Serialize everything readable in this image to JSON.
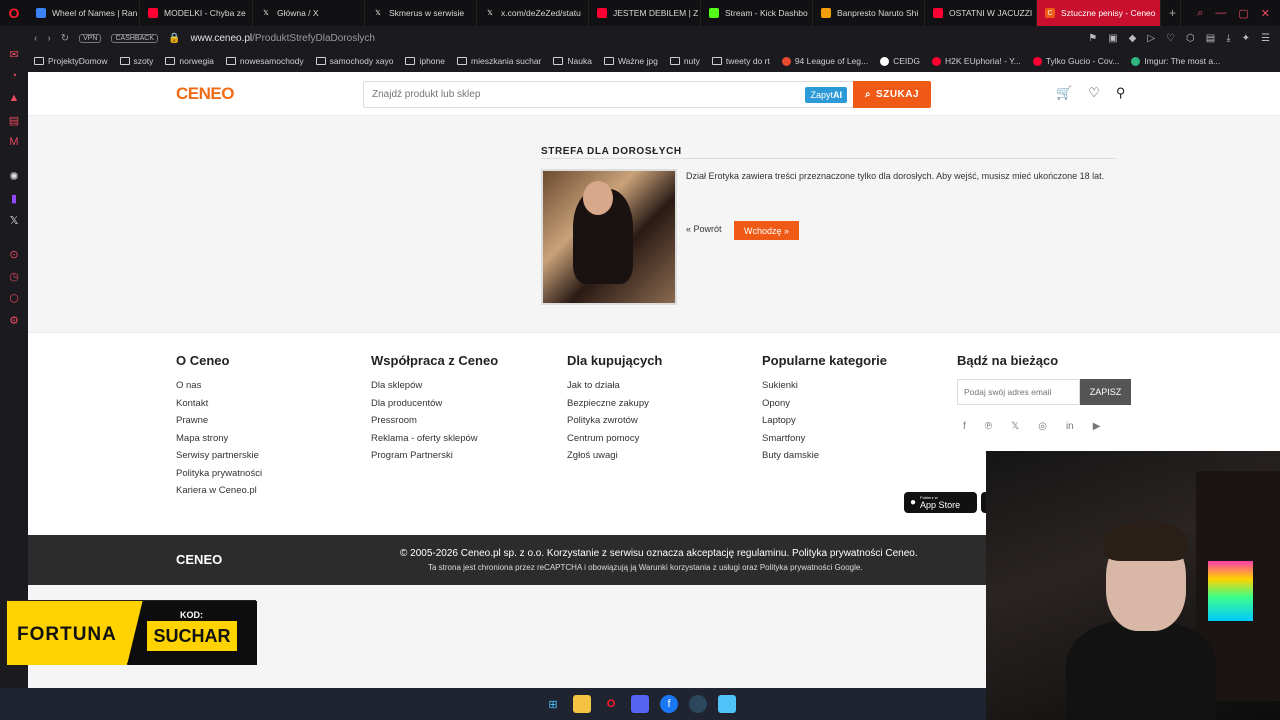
{
  "browser": {
    "tabs": [
      {
        "label": "Wheel of Names | Ran",
        "color": "#3b82f6"
      },
      {
        "label": "MODELKI - Chyba ze",
        "color": "#ff0033"
      },
      {
        "label": "Główna / X",
        "color": "#222"
      },
      {
        "label": "Skmerus w serwisie",
        "color": "#222"
      },
      {
        "label": "x.com/deZeZed/statu",
        "color": "#222"
      },
      {
        "label": "JESTEM DEBILEM | Z",
        "color": "#ff0033"
      },
      {
        "label": "Stream - Kick Dashbo",
        "color": "#53fc18"
      },
      {
        "label": "Banpresto Naruto Shi",
        "color": "#f59e0b"
      },
      {
        "label": "OSTATNI W JACUZZI",
        "color": "#ff0033"
      },
      {
        "label": "Sztuczne penisy - Ceneo",
        "color": "#ef5a17"
      }
    ],
    "url_host": "www.ceneo.pl",
    "url_path": "/ProduktStrefyDlaDoroslych",
    "vpn_label": "VPN",
    "cashback_label": "CASHBACK",
    "bookmarks": [
      {
        "label": "ProjektyDomow",
        "type": "folder"
      },
      {
        "label": "szoty",
        "type": "folder"
      },
      {
        "label": "norwegia",
        "type": "folder"
      },
      {
        "label": "nowesamochody",
        "type": "folder"
      },
      {
        "label": "samochody xayo",
        "type": "folder"
      },
      {
        "label": "iphone",
        "type": "folder"
      },
      {
        "label": "mieszkania suchar",
        "type": "folder"
      },
      {
        "label": "Nauka",
        "type": "folder"
      },
      {
        "label": "Ważne jpg",
        "type": "folder"
      },
      {
        "label": "nuty",
        "type": "folder"
      },
      {
        "label": "tweety do rt",
        "type": "folder"
      },
      {
        "label": "94 League of Leg...",
        "type": "site",
        "color": "#e84a2f"
      },
      {
        "label": "CEIDG",
        "type": "site",
        "color": "#ffffff"
      },
      {
        "label": "H2K EUphoria! - Y...",
        "type": "site",
        "color": "#ff0033"
      },
      {
        "label": "Tylko Gucio - Cov...",
        "type": "site",
        "color": "#ff0033"
      },
      {
        "label": "Imgur: The most a...",
        "type": "site",
        "color": "#2fb67c"
      }
    ]
  },
  "site": {
    "logo": "CENEO",
    "search_placeholder": "Znajdź produkt lub sklep",
    "zapyt_label": "Zapyt",
    "zapyt_ai": "AI",
    "search_button": "SZUKAJ"
  },
  "adult": {
    "title": "STREFA DLA DOROSŁYCH",
    "description": "Dział Erotyka zawiera treści przeznaczone tylko dla dorosłych. Aby wejść, musisz mieć ukończone 18 lat.",
    "back_label": "« Powrót",
    "enter_label": "Wchodzę »"
  },
  "footer": {
    "columns": [
      {
        "title": "O Ceneo",
        "links": [
          "O nas",
          "Kontakt",
          "Prawne",
          "Mapa strony",
          "Serwisy partnerskie",
          "Polityka prywatności",
          "Kariera w Ceneo.pl"
        ]
      },
      {
        "title": "Współpraca z Ceneo",
        "links": [
          "Dla sklepów",
          "Dla producentów",
          "Pressroom",
          "Reklama - oferty sklepów",
          "Program Partnerski"
        ]
      },
      {
        "title": "Dla kupujących",
        "links": [
          "Jak to działa",
          "Bezpieczne zakupy",
          "Polityka zwrotów",
          "Centrum pomocy",
          "Zgłoś uwagi"
        ]
      },
      {
        "title": "Popularne kategorie",
        "links": [
          "Sukienki",
          "Opony",
          "Laptopy",
          "Smartfony",
          "Buty damskie"
        ]
      }
    ],
    "newsletter_title": "Bądź na bieżąco",
    "newsletter_placeholder": "Podaj swój adres email",
    "newsletter_button": "ZAPISZ",
    "store_small": "Pobierz w",
    "store_big": "App Store",
    "bottom_logo": "CENEO",
    "copyright": "© 2005-2026 Ceneo.pl sp. z o.o. Korzystanie z serwisu oznacza akceptację regulaminu. Polityka prywatności Ceneo.",
    "recaptcha": "Ta strona jest chroniona przez reCAPTCHA i obowiązują ją Warunki korzystania z usługi oraz Polityka prywatności Google."
  },
  "overlay": {
    "fortuna_brand": "FORTUNA",
    "kod_label": "KOD:",
    "kod_value": "SUCHAR"
  }
}
